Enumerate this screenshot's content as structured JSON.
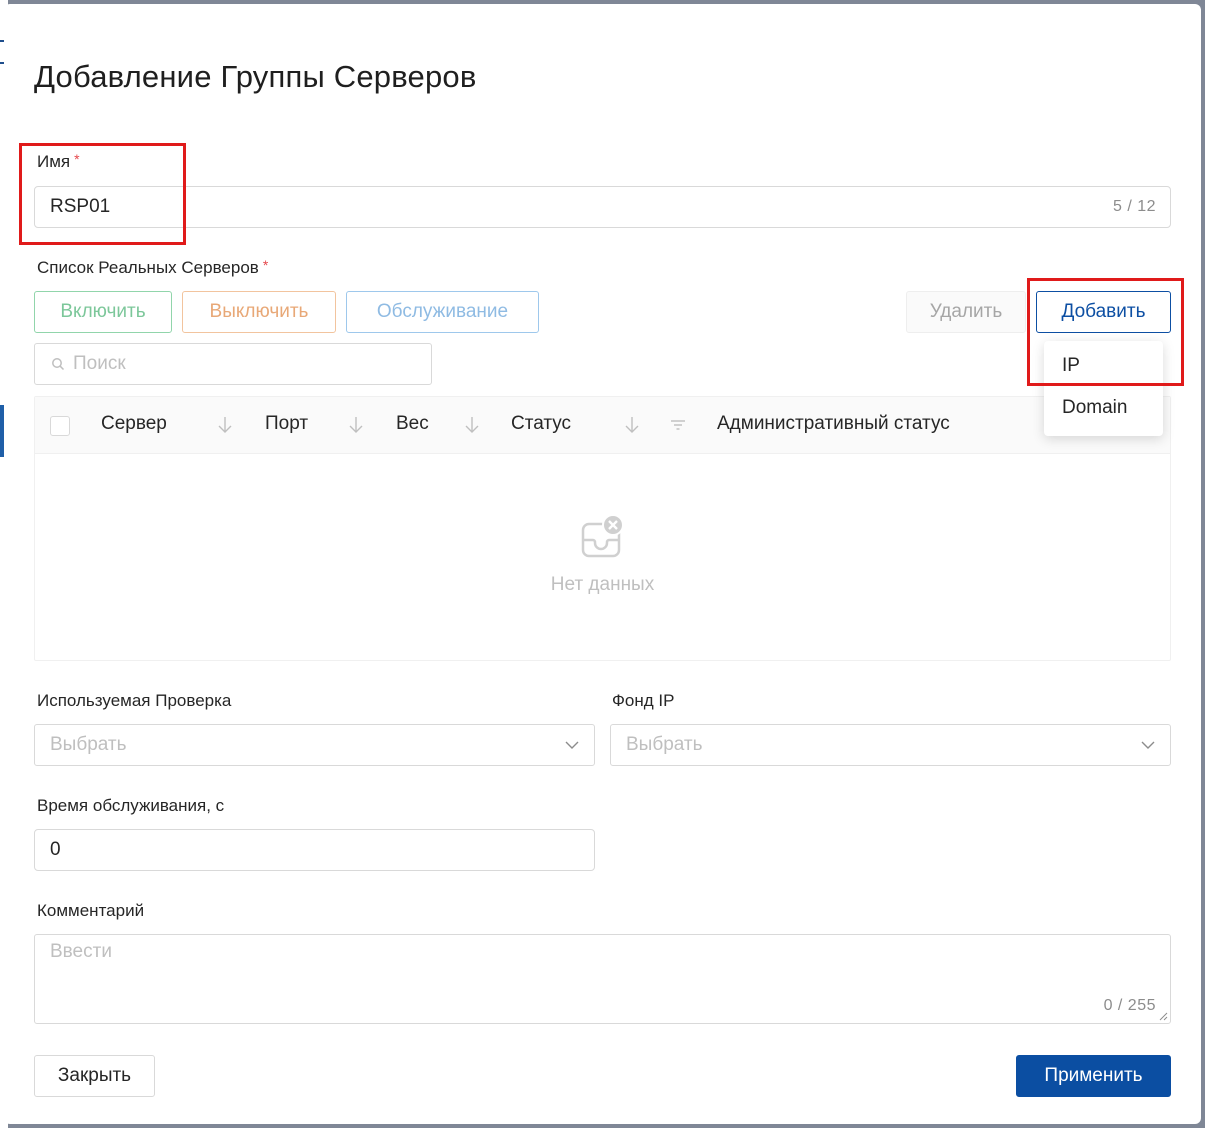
{
  "dialog": {
    "title": "Добавление Группы Серверов"
  },
  "name_field": {
    "label": "Имя",
    "required_mark": "*",
    "value": "RSP01",
    "counter": "5 / 12"
  },
  "servers": {
    "label": "Список Реальных Серверов",
    "required_mark": "*",
    "actions": {
      "enable": "Включить",
      "disable": "Выключить",
      "maintenance": "Обслуживание",
      "delete": "Удалить",
      "add": "Добавить"
    },
    "add_menu": {
      "items": [
        "IP",
        "Domain"
      ]
    },
    "search": {
      "placeholder": "Поиск"
    },
    "table": {
      "columns": [
        "Сервер",
        "Порт",
        "Вес",
        "Статус",
        "Административный статус"
      ],
      "empty_text": "Нет данных"
    }
  },
  "health_check": {
    "label": "Используемая Проверка",
    "placeholder": "Выбрать"
  },
  "ip_pool": {
    "label": "Фонд IP",
    "placeholder": "Выбрать"
  },
  "maintenance_time": {
    "label": "Время обслуживания, с",
    "value": "0"
  },
  "comment": {
    "label": "Комментарий",
    "placeholder": "Ввести",
    "counter": "0 / 255"
  },
  "footer": {
    "close": "Закрыть",
    "apply": "Применить"
  },
  "colors": {
    "primary": "#0b4ea2",
    "highlight": "#e01a1a",
    "enable": "#7cc79a",
    "disable": "#e8a877",
    "maintenance": "#8fbbe3"
  }
}
